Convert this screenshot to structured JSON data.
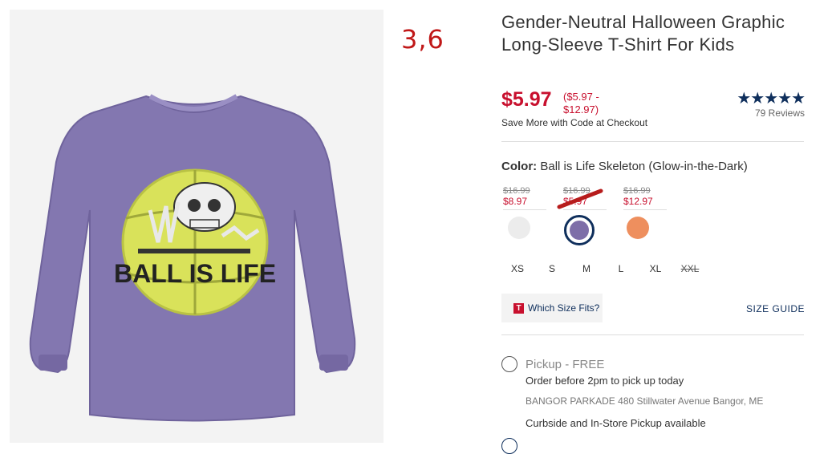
{
  "annotation": "3,6",
  "product": {
    "title": "Gender-Neutral Halloween Graphic Long-Sleeve T-Shirt For Kids",
    "price": "$5.97",
    "price_range": "($5.97 - $12.97)",
    "promo": "Save More with Code at Checkout",
    "stars": "★★★★★",
    "reviews": "79 Reviews",
    "image_text": "BALL IS LIFE"
  },
  "color": {
    "label": "Color:",
    "value": "Ball is Life Skeleton (Glow-in-the-Dark)",
    "swatches": [
      {
        "old_price": "$16.99",
        "sale_price": "$8.97",
        "color": "#ececec"
      },
      {
        "old_price": "$16.99",
        "sale_price": "$5.97",
        "color": "#7e6ea8"
      },
      {
        "old_price": "$16.99",
        "sale_price": "$12.97",
        "color": "#ee8f5e"
      }
    ]
  },
  "sizes": [
    "XS",
    "S",
    "M",
    "L",
    "XL",
    "XXL"
  ],
  "fit": {
    "icon_letter": "T",
    "which_size_label": "Which Size Fits?",
    "size_guide_label": "SIZE GUIDE"
  },
  "pickup": {
    "label": "Pickup - FREE",
    "order_before": "Order before 2pm to pick up today",
    "store_name": "BANGOR PARKADE",
    "store_address": "480 Stillwater Avenue  Bangor, ME",
    "curbside": "Curbside and In-Store Pickup available"
  },
  "colors": {
    "price_red": "#c8102e",
    "navy": "#0f2f5c",
    "shirt_purple": "#8377b0",
    "ball_yellow": "#d9e25a",
    "annotation_red": "#c01818"
  }
}
